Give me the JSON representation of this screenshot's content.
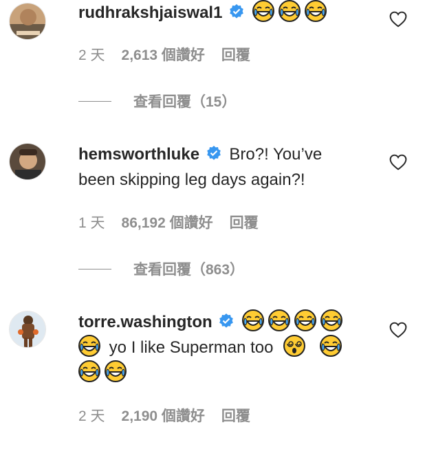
{
  "comments": [
    {
      "username": "rudhrakshjaiswal1",
      "verified": true,
      "text_lines": [],
      "time": "2 天",
      "likes": "2,613 個讚好",
      "reply": "回覆",
      "view_replies": "查看回覆（15）"
    },
    {
      "username": "hemsworthluke",
      "verified": true,
      "text_line1": "Bro?! You’ve",
      "text_line2": "been skipping leg days again?!",
      "time": "1 天",
      "likes": "86,192 個讚好",
      "reply": "回覆",
      "view_replies": "查看回覆（863）"
    },
    {
      "username": "torre.washington",
      "verified": true,
      "text_mid": "yo I like Superman too",
      "time": "2 天",
      "likes": "2,190 個讚好",
      "reply": "回覆"
    }
  ],
  "icons": {
    "like": "heart-outline-icon",
    "verified": "verified-badge-icon",
    "emoji_laugh": "face-with-tears-of-joy",
    "emoji_dizzy": "dizzy-face"
  },
  "colors": {
    "verified": "#3897f0",
    "muted": "#8e8e8e",
    "text": "#262626"
  }
}
